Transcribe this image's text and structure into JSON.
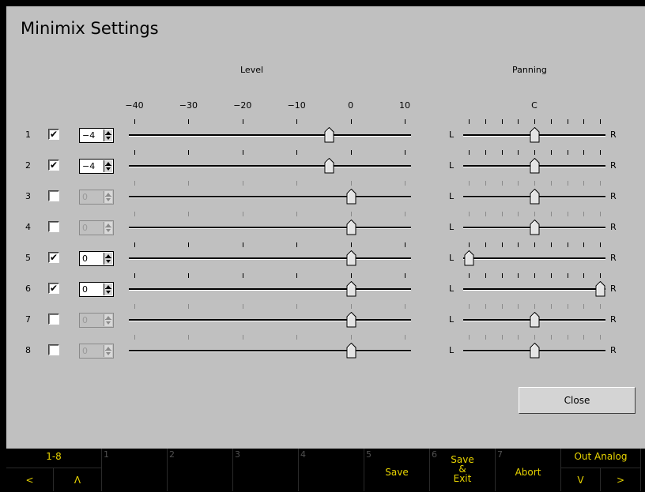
{
  "title": "Minimix Settings",
  "headers": {
    "level": "Level",
    "panning": "Panning"
  },
  "level_scale": [
    "-40",
    "-30",
    "-20",
    "-10",
    "0",
    "10"
  ],
  "pan_scale": {
    "center": "C",
    "left": "L",
    "right": "R"
  },
  "rows": [
    {
      "num": "1",
      "checked": true,
      "check_glyph": "✔",
      "value": "-4",
      "level_db": -4,
      "pan": 0
    },
    {
      "num": "2",
      "checked": true,
      "check_glyph": "✔",
      "value": "-4",
      "level_db": -4,
      "pan": 0
    },
    {
      "num": "3",
      "checked": false,
      "check_glyph": "",
      "value": "0",
      "level_db": 0,
      "pan": 0
    },
    {
      "num": "4",
      "checked": false,
      "check_glyph": "",
      "value": "0",
      "level_db": 0,
      "pan": 0
    },
    {
      "num": "5",
      "checked": true,
      "check_glyph": "✔",
      "value": "0",
      "level_db": 0,
      "pan": -1
    },
    {
      "num": "6",
      "checked": true,
      "check_glyph": "✔",
      "value": "0",
      "level_db": 0,
      "pan": 1
    },
    {
      "num": "7",
      "checked": false,
      "check_glyph": "",
      "value": "0",
      "level_db": 0,
      "pan": 0
    },
    {
      "num": "8",
      "checked": false,
      "check_glyph": "",
      "value": "0",
      "level_db": 0,
      "pan": 0
    }
  ],
  "close_label": "Close",
  "fkeys": [
    {
      "num": "",
      "label": "1-8",
      "sub_left": "<",
      "sub_right": "Λ"
    },
    {
      "num": "1",
      "label": ""
    },
    {
      "num": "2",
      "label": ""
    },
    {
      "num": "3",
      "label": ""
    },
    {
      "num": "4",
      "label": ""
    },
    {
      "num": "5",
      "label": "Save"
    },
    {
      "num": "6",
      "label": "Save\n&\nExit"
    },
    {
      "num": "7",
      "label": "Abort"
    },
    {
      "num": "",
      "label": "Out Analog",
      "sub_left": "V",
      "sub_right": ">"
    }
  ],
  "colors": {
    "panel": "#c0c0c0",
    "fkey_text": "#e8d400",
    "bar": "#000000"
  }
}
